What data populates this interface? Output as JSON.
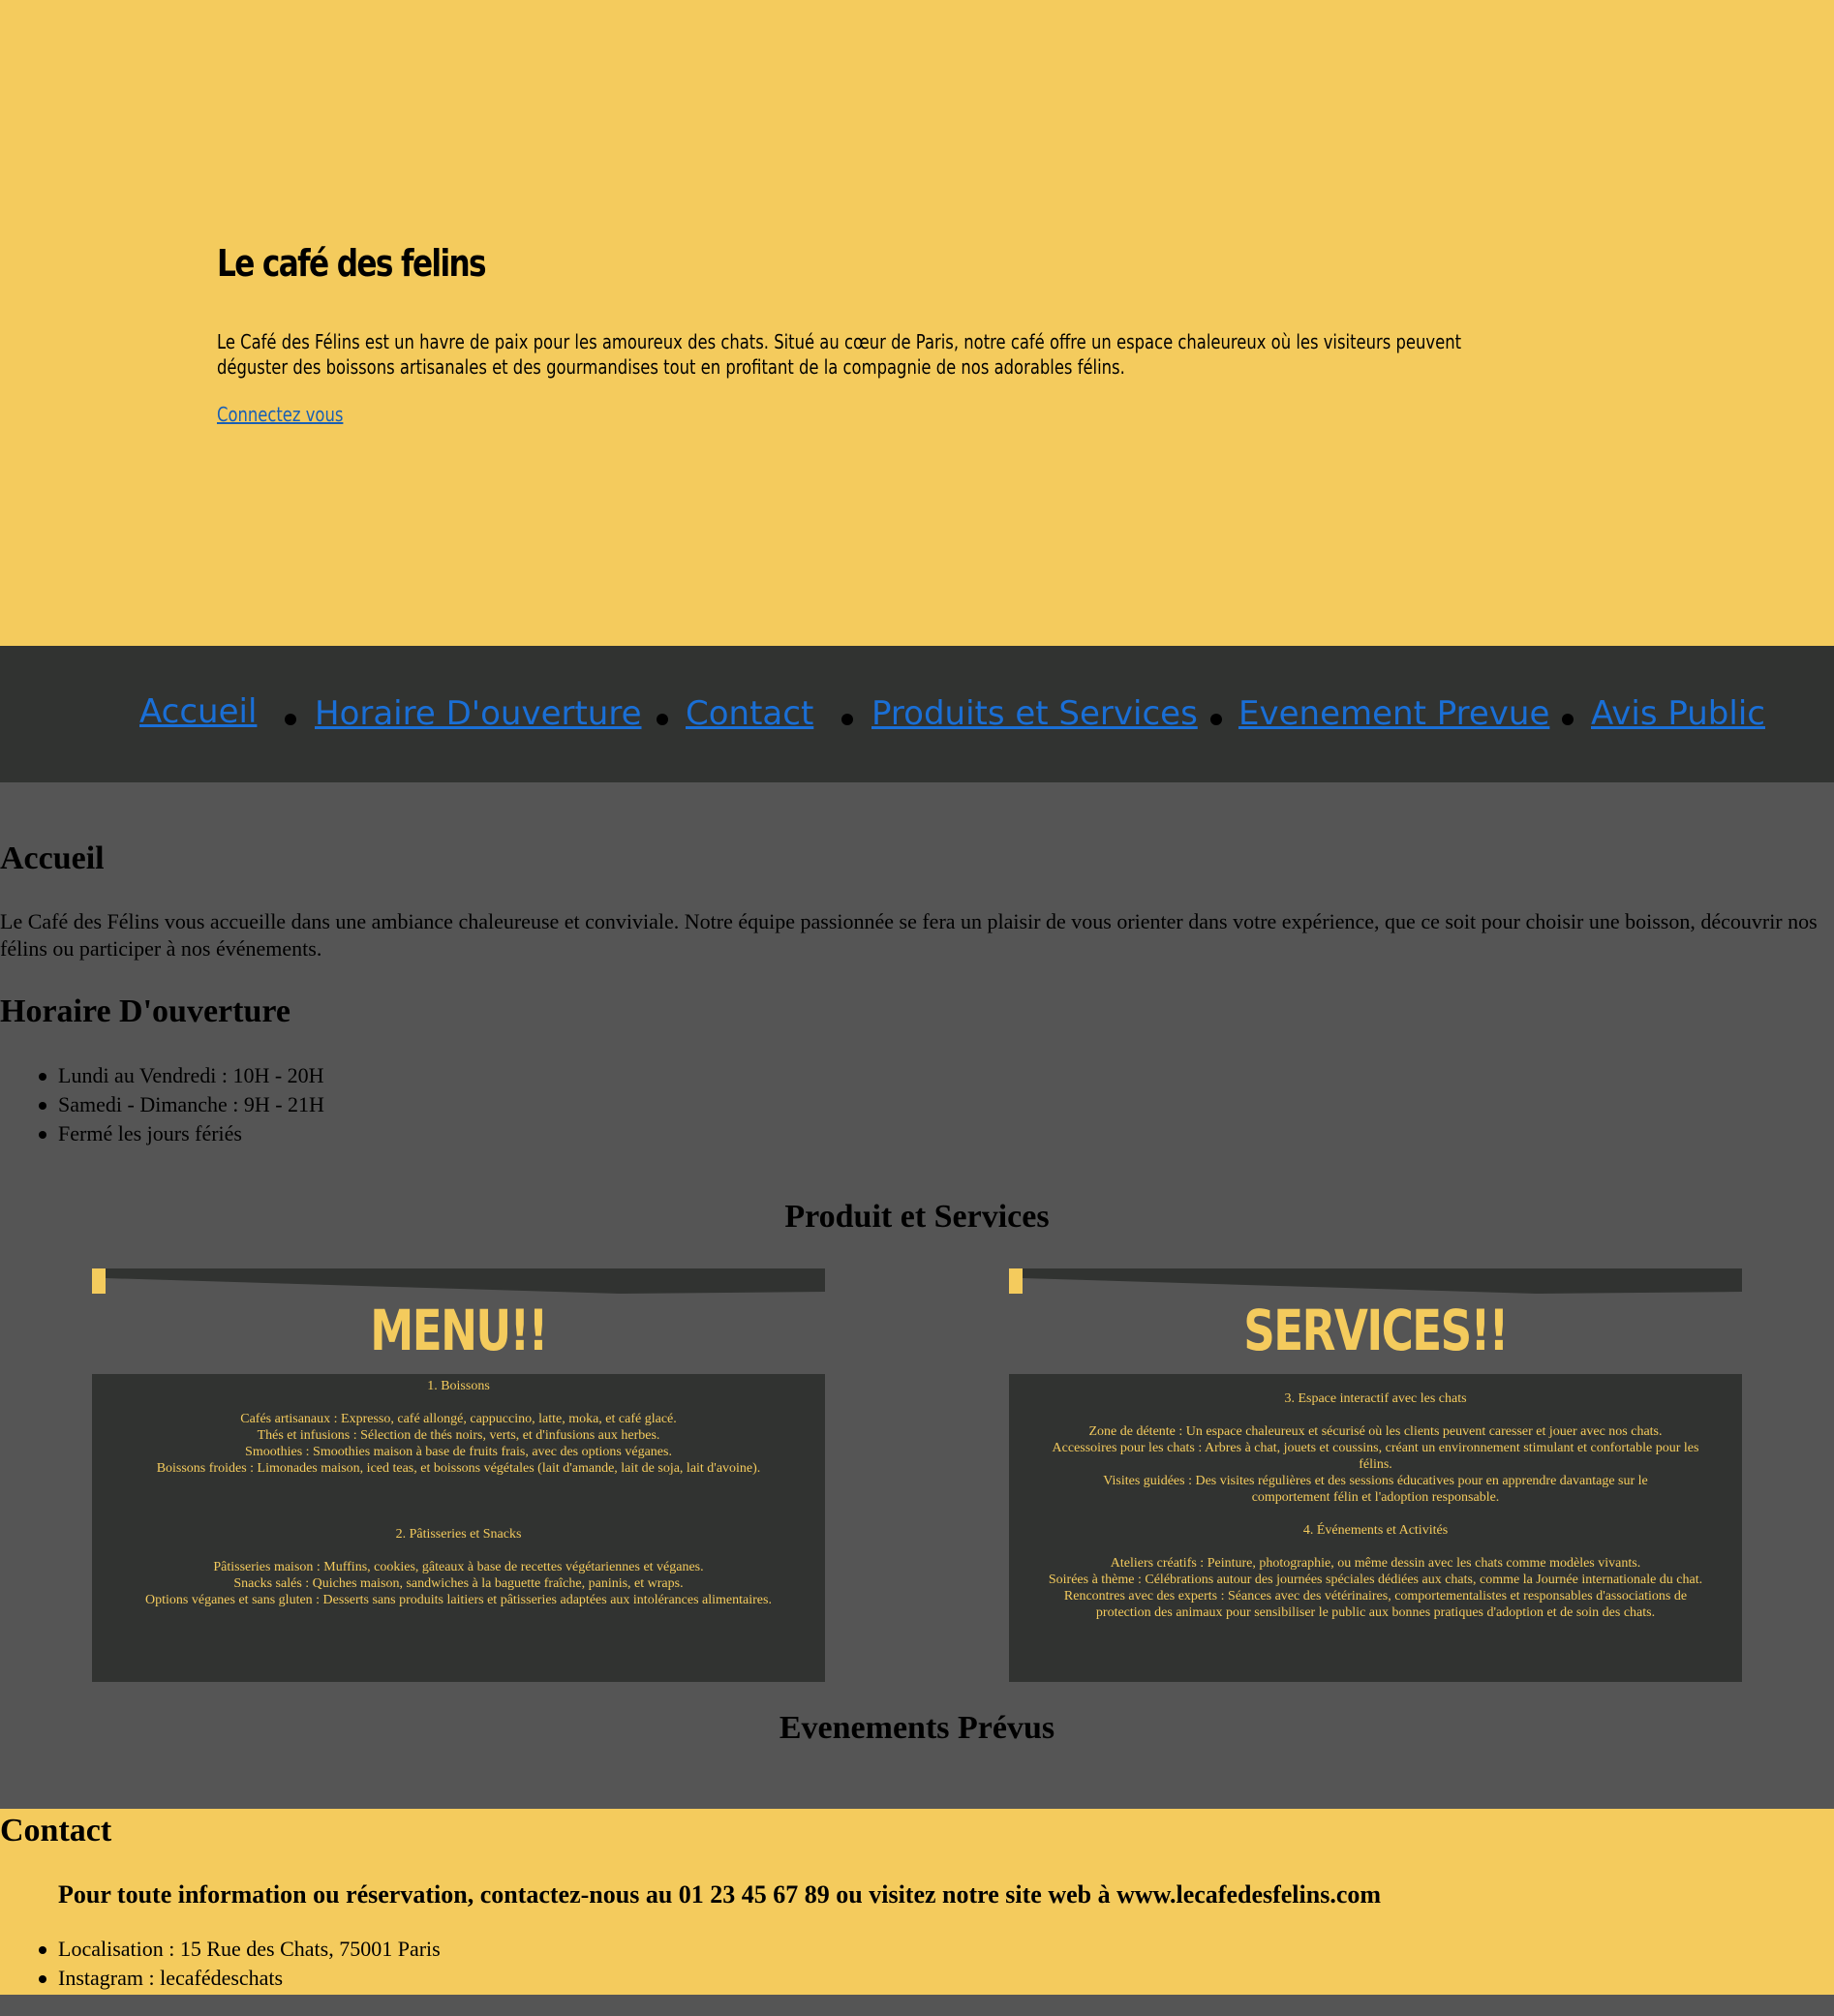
{
  "hero": {
    "title": "Le café des felins",
    "description": "Le Café des Félins est un havre de paix pour les amoureux des chats. Situé au cœur de Paris, notre café offre un espace chaleureux où les visiteurs peuvent déguster des boissons artisanales et des gourmandises tout en profitant de la compagnie de nos adorables félins.",
    "login_link": "Connectez vous"
  },
  "nav": {
    "items": [
      "Accueil",
      "Horaire D'ouverture",
      "Contact",
      "Produits et Services",
      "Evenement Prevue",
      "Avis Public"
    ]
  },
  "accueil": {
    "heading": "Accueil",
    "text": "Le Café des Félins vous accueille dans une ambiance chaleureuse et conviviale. Notre équipe passionnée se fera un plaisir de vous orienter dans votre expérience, que ce soit pour choisir une boisson, découvrir nos félins ou participer à nos événements."
  },
  "horaire": {
    "heading": "Horaire D'ouverture",
    "items": [
      "Lundi au Vendredi : 10H - 20H",
      "Samedi - Dimanche : 9H - 21H",
      "Fermé les jours fériés"
    ]
  },
  "produits": {
    "heading": "Produit et Services",
    "menu": {
      "title": "MENU!!",
      "section1_title": "1. Boissons",
      "section1_lines": [
        "Cafés artisanaux : Expresso, café allongé, cappuccino, latte, moka, et café glacé.",
        "Thés et infusions : Sélection de thés noirs, verts, et d'infusions aux herbes.",
        "Smoothies : Smoothies maison à base de fruits frais, avec des options véganes.",
        "Boissons froides : Limonades maison, iced teas, et boissons végétales (lait d'amande, lait de soja, lait d'avoine)."
      ],
      "section2_title": "2. Pâtisseries et Snacks",
      "section2_lines": [
        "Pâtisseries maison : Muffins, cookies, gâteaux à base de recettes végétariennes et véganes.",
        "Snacks salés : Quiches maison, sandwiches à la baguette fraîche, paninis, et wraps.",
        "Options véganes et sans gluten : Desserts sans produits laitiers et pâtisseries adaptées aux intolérances alimentaires."
      ]
    },
    "services": {
      "title": "SERVICES!!",
      "section3_title": "3. Espace interactif avec les chats",
      "section3_lines": [
        "Zone de détente : Un espace chaleureux et sécurisé où les clients peuvent caresser et jouer avec nos chats.",
        "Accessoires pour les chats : Arbres à chat, jouets et coussins, créant un environnement stimulant et confortable pour les félins.",
        "Visites guidées : Des visites régulières et des sessions éducatives pour en apprendre davantage sur le comportement félin et l'adoption responsable."
      ],
      "section4_title": "4. Événements et Activités",
      "section4_lines": [
        "Ateliers créatifs : Peinture, photographie, ou même dessin avec les chats comme modèles vivants.",
        "Soirées à thème : Célébrations autour des journées spéciales dédiées aux chats, comme la Journée internationale du chat.",
        "Rencontres avec des experts : Séances avec des vétérinaires, comportementalistes et responsables d'associations de protection des animaux pour sensibiliser le public aux bonnes pratiques d'adoption et de soin des chats."
      ]
    }
  },
  "evenements": {
    "heading": "Evenements Prévus"
  },
  "contact": {
    "heading": "Contact",
    "subheading": "Pour toute information ou réservation, contactez-nous au 01 23 45 67 89 ou visitez notre site web à www.lecafedesfelins.com",
    "items": [
      "Localisation : 15 Rue des Chats, 75001 Paris",
      "Instagram : lecafédeschats"
    ]
  },
  "colors": {
    "accent_yellow": "#f4cb5d",
    "dark_panel": "#313331",
    "main_bg": "#555555",
    "link_blue": "#1a6fd6"
  }
}
